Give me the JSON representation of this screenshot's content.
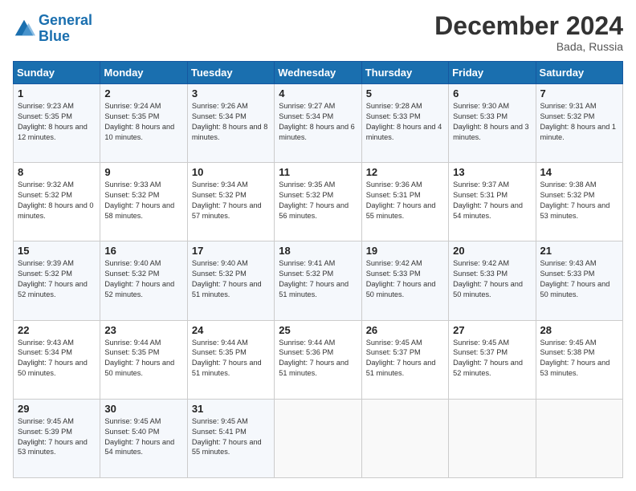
{
  "logo": {
    "line1": "General",
    "line2": "Blue"
  },
  "header": {
    "month": "December 2024",
    "location": "Bada, Russia"
  },
  "weekdays": [
    "Sunday",
    "Monday",
    "Tuesday",
    "Wednesday",
    "Thursday",
    "Friday",
    "Saturday"
  ],
  "weeks": [
    [
      {
        "day": "1",
        "sunrise": "9:23 AM",
        "sunset": "5:35 PM",
        "daylight": "8 hours and 12 minutes."
      },
      {
        "day": "2",
        "sunrise": "9:24 AM",
        "sunset": "5:35 PM",
        "daylight": "8 hours and 10 minutes."
      },
      {
        "day": "3",
        "sunrise": "9:26 AM",
        "sunset": "5:34 PM",
        "daylight": "8 hours and 8 minutes."
      },
      {
        "day": "4",
        "sunrise": "9:27 AM",
        "sunset": "5:34 PM",
        "daylight": "8 hours and 6 minutes."
      },
      {
        "day": "5",
        "sunrise": "9:28 AM",
        "sunset": "5:33 PM",
        "daylight": "8 hours and 4 minutes."
      },
      {
        "day": "6",
        "sunrise": "9:30 AM",
        "sunset": "5:33 PM",
        "daylight": "8 hours and 3 minutes."
      },
      {
        "day": "7",
        "sunrise": "9:31 AM",
        "sunset": "5:32 PM",
        "daylight": "8 hours and 1 minute."
      }
    ],
    [
      {
        "day": "8",
        "sunrise": "9:32 AM",
        "sunset": "5:32 PM",
        "daylight": "8 hours and 0 minutes."
      },
      {
        "day": "9",
        "sunrise": "9:33 AM",
        "sunset": "5:32 PM",
        "daylight": "7 hours and 58 minutes."
      },
      {
        "day": "10",
        "sunrise": "9:34 AM",
        "sunset": "5:32 PM",
        "daylight": "7 hours and 57 minutes."
      },
      {
        "day": "11",
        "sunrise": "9:35 AM",
        "sunset": "5:32 PM",
        "daylight": "7 hours and 56 minutes."
      },
      {
        "day": "12",
        "sunrise": "9:36 AM",
        "sunset": "5:31 PM",
        "daylight": "7 hours and 55 minutes."
      },
      {
        "day": "13",
        "sunrise": "9:37 AM",
        "sunset": "5:31 PM",
        "daylight": "7 hours and 54 minutes."
      },
      {
        "day": "14",
        "sunrise": "9:38 AM",
        "sunset": "5:32 PM",
        "daylight": "7 hours and 53 minutes."
      }
    ],
    [
      {
        "day": "15",
        "sunrise": "9:39 AM",
        "sunset": "5:32 PM",
        "daylight": "7 hours and 52 minutes."
      },
      {
        "day": "16",
        "sunrise": "9:40 AM",
        "sunset": "5:32 PM",
        "daylight": "7 hours and 52 minutes."
      },
      {
        "day": "17",
        "sunrise": "9:40 AM",
        "sunset": "5:32 PM",
        "daylight": "7 hours and 51 minutes."
      },
      {
        "day": "18",
        "sunrise": "9:41 AM",
        "sunset": "5:32 PM",
        "daylight": "7 hours and 51 minutes."
      },
      {
        "day": "19",
        "sunrise": "9:42 AM",
        "sunset": "5:33 PM",
        "daylight": "7 hours and 50 minutes."
      },
      {
        "day": "20",
        "sunrise": "9:42 AM",
        "sunset": "5:33 PM",
        "daylight": "7 hours and 50 minutes."
      },
      {
        "day": "21",
        "sunrise": "9:43 AM",
        "sunset": "5:33 PM",
        "daylight": "7 hours and 50 minutes."
      }
    ],
    [
      {
        "day": "22",
        "sunrise": "9:43 AM",
        "sunset": "5:34 PM",
        "daylight": "7 hours and 50 minutes."
      },
      {
        "day": "23",
        "sunrise": "9:44 AM",
        "sunset": "5:35 PM",
        "daylight": "7 hours and 50 minutes."
      },
      {
        "day": "24",
        "sunrise": "9:44 AM",
        "sunset": "5:35 PM",
        "daylight": "7 hours and 51 minutes."
      },
      {
        "day": "25",
        "sunrise": "9:44 AM",
        "sunset": "5:36 PM",
        "daylight": "7 hours and 51 minutes."
      },
      {
        "day": "26",
        "sunrise": "9:45 AM",
        "sunset": "5:37 PM",
        "daylight": "7 hours and 51 minutes."
      },
      {
        "day": "27",
        "sunrise": "9:45 AM",
        "sunset": "5:37 PM",
        "daylight": "7 hours and 52 minutes."
      },
      {
        "day": "28",
        "sunrise": "9:45 AM",
        "sunset": "5:38 PM",
        "daylight": "7 hours and 53 minutes."
      }
    ],
    [
      {
        "day": "29",
        "sunrise": "9:45 AM",
        "sunset": "5:39 PM",
        "daylight": "7 hours and 53 minutes."
      },
      {
        "day": "30",
        "sunrise": "9:45 AM",
        "sunset": "5:40 PM",
        "daylight": "7 hours and 54 minutes."
      },
      {
        "day": "31",
        "sunrise": "9:45 AM",
        "sunset": "5:41 PM",
        "daylight": "7 hours and 55 minutes."
      },
      null,
      null,
      null,
      null
    ]
  ]
}
